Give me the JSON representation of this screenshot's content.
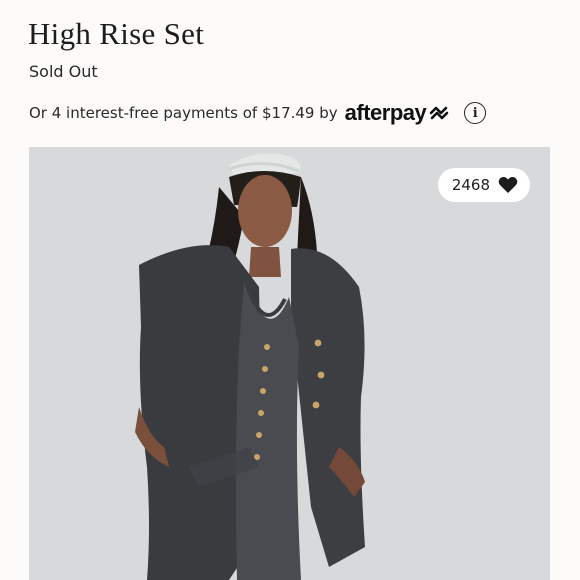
{
  "product": {
    "title": "High Rise Set",
    "status": "Sold Out"
  },
  "payments": {
    "text": "Or 4 interest-free payments of $17.49 by",
    "provider": "afterpay",
    "info_icon": "info-icon"
  },
  "photo": {
    "likes_count": "2468",
    "like_icon": "heart-icon"
  }
}
